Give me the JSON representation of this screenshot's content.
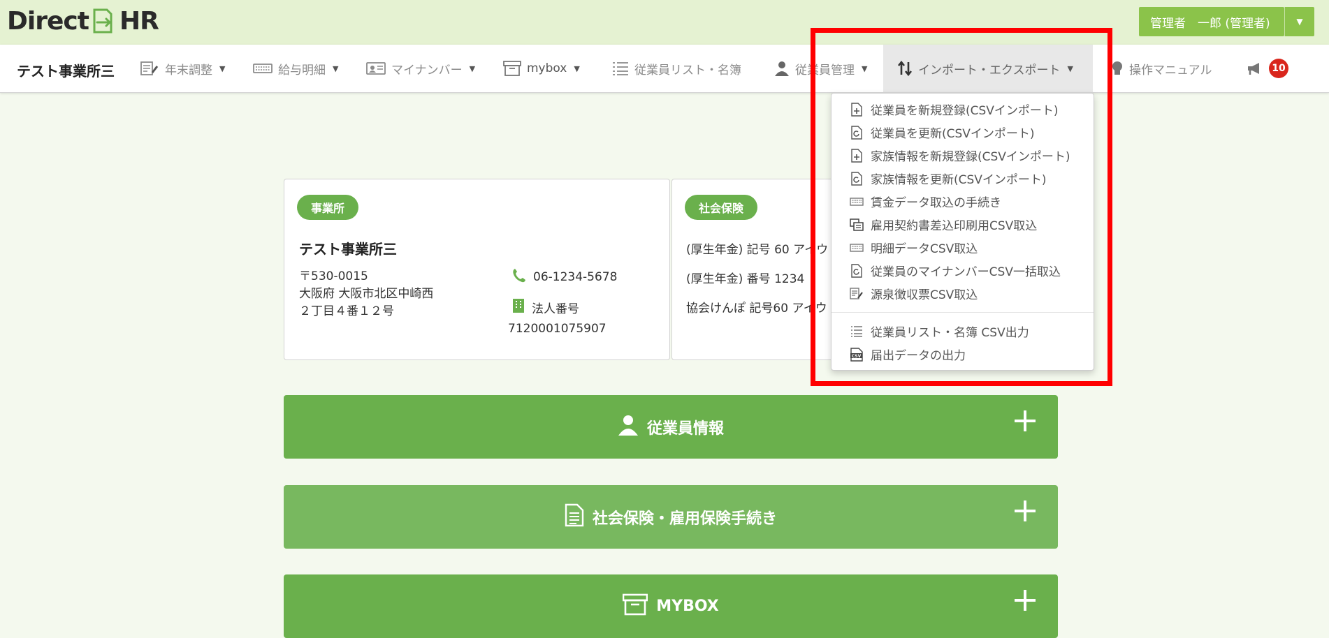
{
  "header": {
    "logo_left": "Direct",
    "logo_right": "HR",
    "user_label": "管理者　一郎 (管理者)"
  },
  "nav": {
    "brand": "テスト事業所三",
    "items": [
      {
        "label": "年末調整",
        "icon": "document-edit-icon"
      },
      {
        "label": "給与明細",
        "icon": "keyboard-icon"
      },
      {
        "label": "マイナンバー",
        "icon": "id-card-icon"
      },
      {
        "label": "mybox",
        "icon": "archive-box-icon"
      },
      {
        "label": "従業員リスト・名簿",
        "icon": "list-icon"
      },
      {
        "label": "従業員管理",
        "icon": "user-icon"
      },
      {
        "label": "インポート・エクスポート",
        "icon": "sort-arrows-icon"
      },
      {
        "label": "操作マニュアル",
        "icon": "lightbulb-icon"
      }
    ],
    "notification_count": "10"
  },
  "dropdown": {
    "items": [
      {
        "label": "従業員を新規登録(CSVインポート)",
        "icon": "file-plus-icon"
      },
      {
        "label": "従業員を更新(CSVインポート)",
        "icon": "file-refresh-icon"
      },
      {
        "label": "家族情報を新規登録(CSVインポート)",
        "icon": "file-plus-icon"
      },
      {
        "label": "家族情報を更新(CSVインポート)",
        "icon": "file-refresh-icon"
      },
      {
        "label": "賃金データ取込の手続き",
        "icon": "keyboard-icon"
      },
      {
        "label": "雇用契約書差込印刷用CSV取込",
        "icon": "print-window-icon"
      },
      {
        "label": "明細データCSV取込",
        "icon": "keyboard-icon"
      },
      {
        "label": "従業員のマイナンバーCSV一括取込",
        "icon": "file-refresh-icon"
      },
      {
        "label": "源泉徴収票CSV取込",
        "icon": "document-edit-icon"
      }
    ],
    "export_items": [
      {
        "label": "従業員リスト・名簿 CSV出力",
        "icon": "list-icon"
      },
      {
        "label": "届出データの出力",
        "icon": "csv-icon"
      }
    ]
  },
  "office_card": {
    "pill": "事業所",
    "name": "テスト事業所三",
    "postal": "〒530-0015",
    "address1": "大阪府 大阪市北区中崎西",
    "address2": "２丁目４番１２号",
    "phone": "06-1234-5678",
    "corp_label": "法人番号",
    "corp_number": "7120001075907"
  },
  "insurance_card": {
    "pill": "社会保険",
    "line1": "(厚生年金) 記号 60 アイウ",
    "line2": "(厚生年金) 番号 1234",
    "line3": "協会けんぽ 記号60 アイウ"
  },
  "sections": [
    {
      "label": "従業員情報",
      "icon": "user-icon"
    },
    {
      "label": "社会保険・雇用保険手続き",
      "icon": "document-icon"
    },
    {
      "label": "MYBOX",
      "icon": "archive-box-icon"
    }
  ],
  "colors": {
    "header_bg": "#e5f2d2",
    "accent_green": "#6ab04c",
    "user_button": "#8bc34a",
    "badge_red": "#d9261c",
    "highlight_red": "#ff0000"
  }
}
